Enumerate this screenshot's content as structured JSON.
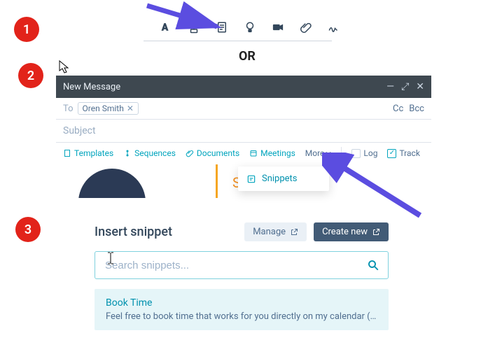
{
  "steps": {
    "one": "1",
    "two": "2",
    "three": "3"
  },
  "top_icons": {
    "a": "text-format-icon",
    "b": "snippet-icon",
    "c": "document-icon",
    "d": "knowledge-icon",
    "e": "video-icon",
    "f": "attachment-icon",
    "g": "signature-icon"
  },
  "or_label": "OR",
  "compose": {
    "title": "New Message",
    "window_controls": {
      "min": "—",
      "expand": "⤢",
      "close": "✕"
    },
    "to_label": "To",
    "recipient": "Oren Smith",
    "cc": "Cc",
    "bcc": "Bcc",
    "subject_placeholder": "Subject",
    "insert": {
      "templates": "Templates",
      "sequences": "Sequences",
      "documents": "Documents",
      "meetings": "Meetings",
      "more": "More",
      "log": "Log",
      "track": "Track"
    },
    "dropdown": {
      "snippets": "Snippets"
    },
    "signature_name": "Susan LaP"
  },
  "panel": {
    "title": "Insert snippet",
    "manage": "Manage",
    "create": "Create new",
    "search_placeholder": "Search snippets...",
    "result": {
      "title": "Book Time",
      "preview": "Feel free to book time that works for you directly on my calendar (li..."
    }
  },
  "colors": {
    "step": "#e2231a",
    "teal": "#00a4bd",
    "arrow": "#5b4de0",
    "orange": "#f5911e",
    "primary": "#425b76"
  }
}
